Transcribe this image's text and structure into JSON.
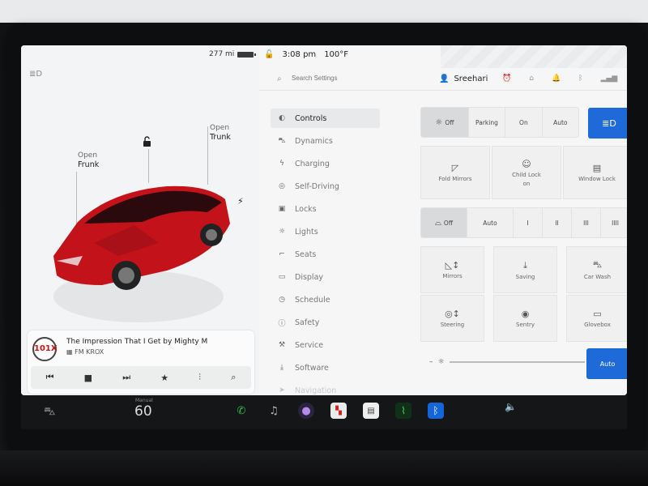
{
  "status": {
    "range": "277 mi",
    "time": "3:08 pm",
    "temperature": "100°F"
  },
  "car": {
    "frunk_open_label": "Open",
    "frunk_label": "Frunk",
    "trunk_open_label": "Open",
    "trunk_label": "Trunk",
    "body_color": "#c4121b"
  },
  "media": {
    "station_logo": "101X",
    "title": "The Impression That I Get by Mighty M",
    "station": "FM KROX",
    "controls": [
      "previous-icon",
      "stop-icon",
      "next-icon",
      "favorite-icon",
      "equalizer-icon",
      "search-icon"
    ]
  },
  "search": {
    "placeholder": "Search Settings"
  },
  "user": {
    "name": "Sreehari"
  },
  "menu": {
    "items": [
      {
        "label": "Controls",
        "icon": "toggle-icon"
      },
      {
        "label": "Dynamics",
        "icon": "car-icon"
      },
      {
        "label": "Charging",
        "icon": "bolt-icon"
      },
      {
        "label": "Self-Driving",
        "icon": "steering-icon"
      },
      {
        "label": "Locks",
        "icon": "lock-icon"
      },
      {
        "label": "Lights",
        "icon": "sun-icon"
      },
      {
        "label": "Seats",
        "icon": "seat-icon"
      },
      {
        "label": "Display",
        "icon": "display-icon"
      },
      {
        "label": "Schedule",
        "icon": "clock-icon"
      },
      {
        "label": "Safety",
        "icon": "info-icon"
      },
      {
        "label": "Service",
        "icon": "wrench-icon"
      },
      {
        "label": "Software",
        "icon": "download-icon"
      },
      {
        "label": "Navigation",
        "icon": "navigation-icon"
      }
    ],
    "active": "Controls"
  },
  "controls": {
    "lights_modes": [
      "Off",
      "Parking",
      "On",
      "Auto"
    ],
    "lights_selected": "Off",
    "fold_mirrors": "Fold Mirrors",
    "child_lock": "Child Lock",
    "child_lock_state": "on",
    "window_lock": "Window Lock",
    "wiper_modes": [
      "Off",
      "Auto",
      "I",
      "II",
      "III",
      "IIII"
    ],
    "wiper_selected": "Off",
    "tiles_row1": [
      "Mirrors",
      "Saving",
      "Car Wash"
    ],
    "tiles_row2": [
      "Steering",
      "Sentry",
      "Glovebox"
    ],
    "brightness_auto": "Auto",
    "accent_color": "#1d6ad8"
  },
  "dock": {
    "temp_label": "Manual",
    "temp": "60",
    "apps": [
      "phone-icon",
      "music-icon",
      "camera-icon",
      "toybox-icon",
      "calendar-icon",
      "energy-icon",
      "bluetooth-icon"
    ]
  }
}
